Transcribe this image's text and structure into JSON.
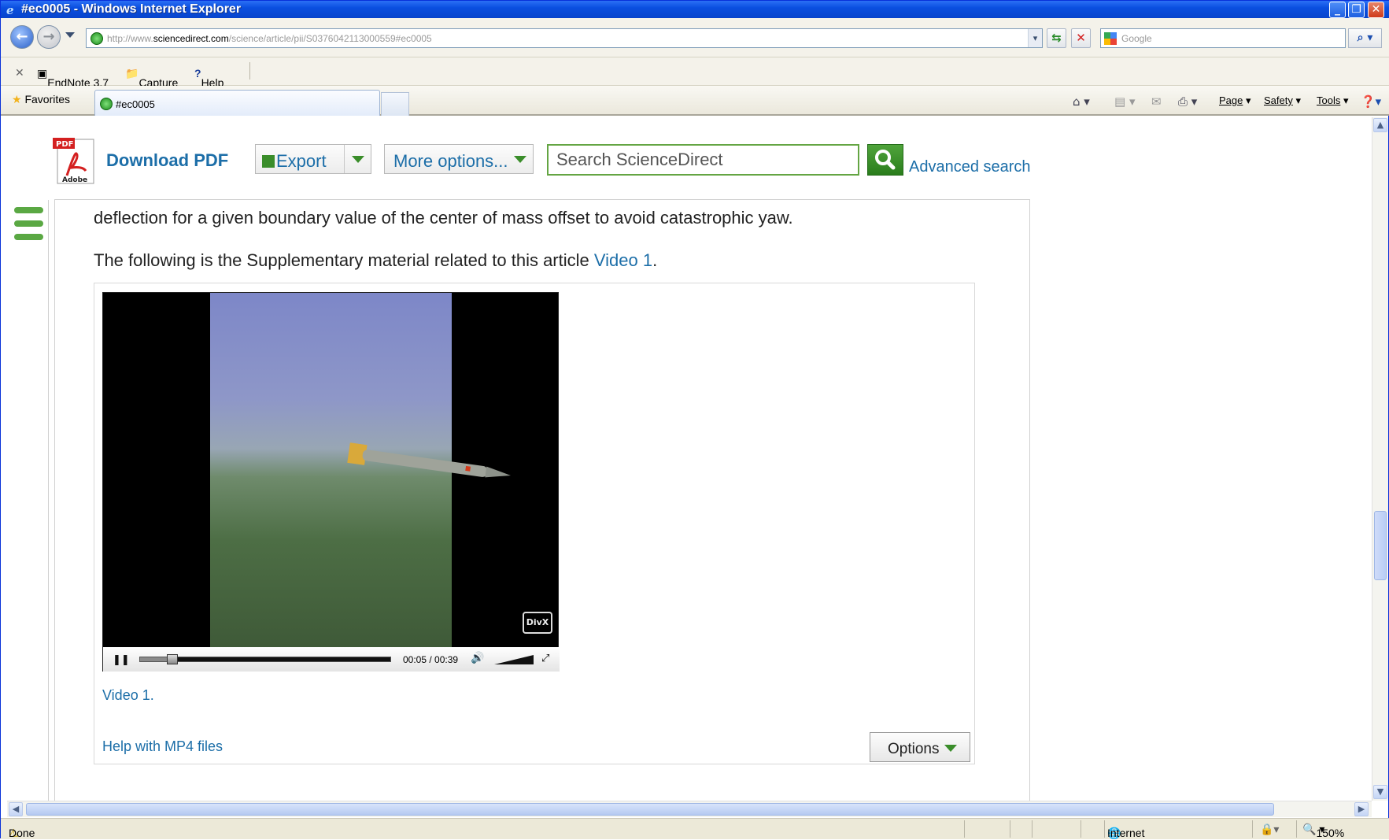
{
  "window": {
    "title": "#ec0005 - Windows Internet Explorer"
  },
  "address": {
    "url_prefix": "http://www.",
    "url_domain": "sciencedirect.com",
    "url_path": "/science/article/pii/S0376042113000559#ec0005",
    "search_placeholder": "Google"
  },
  "links_bar": {
    "endnote": "EndNote 3.7",
    "capture": "Capture",
    "help": "Help"
  },
  "tabs_bar": {
    "favorites": "Favorites",
    "tab_title": "#ec0005",
    "commands": {
      "page": "Page",
      "safety": "Safety",
      "tools": "Tools"
    }
  },
  "toolbar": {
    "download_pdf": "Download PDF",
    "export": "Export",
    "more_options": "More options...",
    "search_placeholder": "Search ScienceDirect",
    "advanced_search": "Advanced search"
  },
  "article": {
    "para1": "deflection for a given boundary value of the center of mass offset to avoid catastrophic yaw.",
    "para2_text": "The following is the Supplementary material related to this article ",
    "para2_link": "Video 1",
    "para2_end": "."
  },
  "video": {
    "current_time": "00:05",
    "duration": "00:39",
    "progress": 0.13,
    "watermark": "DivX",
    "caption": "Video 1.",
    "help_link": "Help with MP4 files",
    "options_label": "Options"
  },
  "status_bar": {
    "status": "Done",
    "zone": "Internet",
    "zoom": "150%"
  },
  "colors": {
    "link": "#1c6ea8",
    "accent_green": "#3a8d2a",
    "title_blue": "#0a4fe0"
  }
}
